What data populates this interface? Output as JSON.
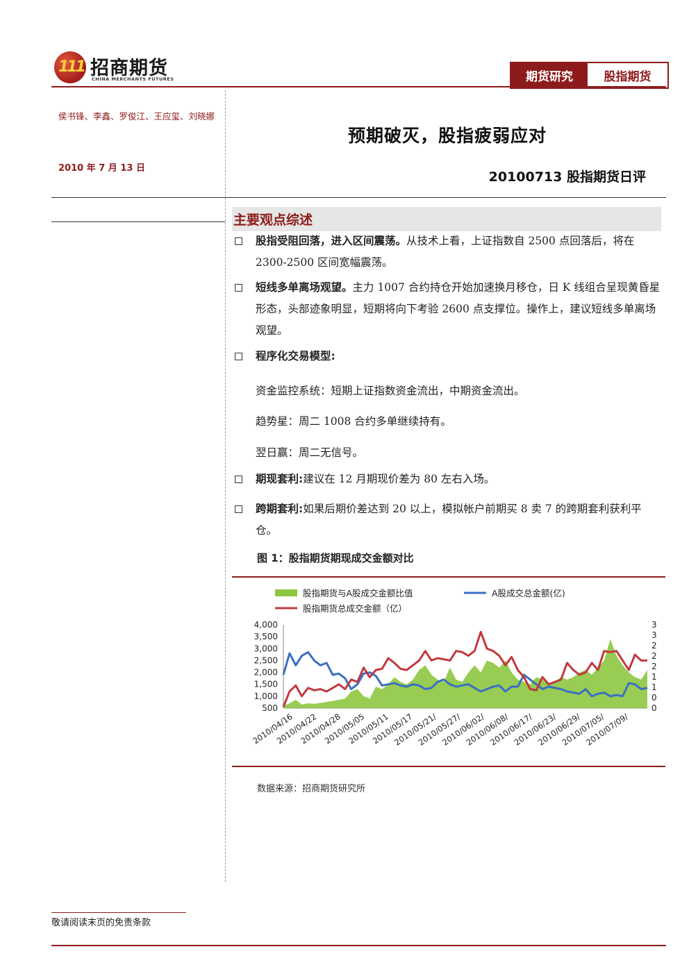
{
  "header": {
    "logo_cn": "招商期货",
    "logo_en": "CHINA MERCHANTS FUTURES",
    "logo_mark": "111",
    "tag_research": "期货研究",
    "tag_topic": "股指期货"
  },
  "sidebar": {
    "authors": "侯书锋、李鑫、罗俊江、王应玺、刘晓娜",
    "date": "2010 年 7 月 13 日"
  },
  "title": "预期破灭，股指疲弱应对",
  "subtitle": "20100713 股指期货日评",
  "section_heading": "主要观点综述",
  "bullets": [
    {
      "head": "股指受阻回落，进入区间震荡。",
      "body": "从技术上看，上证指数自 2500 点回落后，将在 2300-2500 区间宽幅震荡。"
    },
    {
      "head": "短线多单离场观望。",
      "body": "主力 1007 合约持仓开始加速换月移仓，日 K 线组合呈现黄昏星形态，头部迹象明显，短期将向下考验 2600 点支撑位。操作上，建议短线多单离场观望。"
    },
    {
      "head": "程序化交易模型:",
      "body": ""
    },
    {
      "head": "期现套利:",
      "body": "建议在 12 月期现价差为 80 左右入场。"
    },
    {
      "head": "跨期套利:",
      "body": "如果后期价差达到 20 以上，模拟帐户前期买 8 卖 7 的跨期套利获利平仓。"
    }
  ],
  "model_lines": [
    "资金监控系统：短期上证指数资金流出，中期资金流出。",
    "趋势星：周二 1008 合约多单继续持有。",
    "翌日赢：周二无信号。"
  ],
  "figure_title": "图 1：股指期货期现成交金额对比",
  "source": "数据来源：招商期货研究所",
  "footer": "敬请阅读末页的免责条款",
  "colors": {
    "brand": "#8e1b1b",
    "ratio": "#8dc63f",
    "a_share": "#3a6fc4",
    "futures": "#c0393d"
  },
  "chart_data": {
    "type": "line",
    "legend": [
      "股指期货与A股成交金额比值",
      "A股成交总金额(亿)",
      "股指期货总成交金额（亿）"
    ],
    "legend_placement": "top",
    "ylim_left": [
      500,
      4000
    ],
    "yticks_left": [
      "4,000",
      "3,500",
      "3,000",
      "2,500",
      "2,000",
      "1,500",
      "1,000",
      "500"
    ],
    "yticks_right": [
      "3",
      "3",
      "2",
      "2",
      "2",
      "1",
      "1",
      "0",
      "0"
    ],
    "xticks": [
      "2010/04/16",
      "2010/04/22",
      "2010/04/28",
      "2010/05/05",
      "2010/05/11",
      "2010/05/17",
      "2010/05/21/",
      "2010/05/27/",
      "2010/06/02/",
      "2010/06/08/",
      "2010/06/17/",
      "2010/06/23/",
      "2010/06/29/",
      "2010/07/05/",
      "2010/07/09/"
    ],
    "series": [
      {
        "name": "股指期货与A股成交金额比值",
        "kind": "area",
        "values": [
          600,
          700,
          850,
          650,
          700,
          680,
          720,
          760,
          800,
          850,
          900,
          1200,
          1300,
          1000,
          900,
          1400,
          1300,
          1500,
          1800,
          1600,
          1500,
          1700,
          2100,
          2300,
          1900,
          1700,
          1600,
          2200,
          1700,
          1600,
          2000,
          2300,
          2000,
          2500,
          2400,
          2200,
          2500,
          2000,
          1700,
          1600,
          1500,
          1800,
          1700,
          1500,
          1600,
          1800,
          1700,
          1800,
          2000,
          2100,
          1900,
          2200,
          2500,
          3400,
          2700,
          2300,
          2000,
          1800,
          1700,
          2100
        ]
      },
      {
        "name": "A股成交总金额(亿)",
        "kind": "line",
        "values": [
          1900,
          2800,
          2300,
          2700,
          2850,
          2500,
          2300,
          2400,
          1900,
          1950,
          1750,
          1300,
          1500,
          1950,
          2000,
          1850,
          1450,
          1500,
          1550,
          1450,
          1400,
          1500,
          1450,
          1300,
          1350,
          1600,
          1700,
          1500,
          1400,
          1450,
          1500,
          1350,
          1200,
          1300,
          1400,
          1450,
          1200,
          1400,
          1400,
          1900,
          1700,
          1500,
          1300,
          1400,
          1350,
          1300,
          1200,
          1150,
          1100,
          1300,
          1000,
          1100,
          1150,
          1000,
          1050,
          1000,
          1550,
          1500,
          1300,
          1350
        ]
      },
      {
        "name": "股指期货总成交金额（亿）",
        "kind": "line",
        "values": [
          550,
          1200,
          1450,
          1000,
          1350,
          1250,
          1300,
          1200,
          1350,
          1500,
          1300,
          1700,
          1600,
          2200,
          1800,
          2100,
          2150,
          2600,
          2400,
          2150,
          2100,
          2300,
          2500,
          2900,
          2500,
          2600,
          2550,
          2500,
          2900,
          2850,
          2700,
          2900,
          3700,
          3000,
          2900,
          2700,
          2300,
          2650,
          2100,
          1800,
          1300,
          1250,
          1800,
          1500,
          1600,
          1700,
          2400,
          2100,
          1900,
          2000,
          2400,
          2100,
          2900,
          2850,
          2900,
          2500,
          2100,
          2750,
          2500,
          2500
        ]
      }
    ]
  }
}
